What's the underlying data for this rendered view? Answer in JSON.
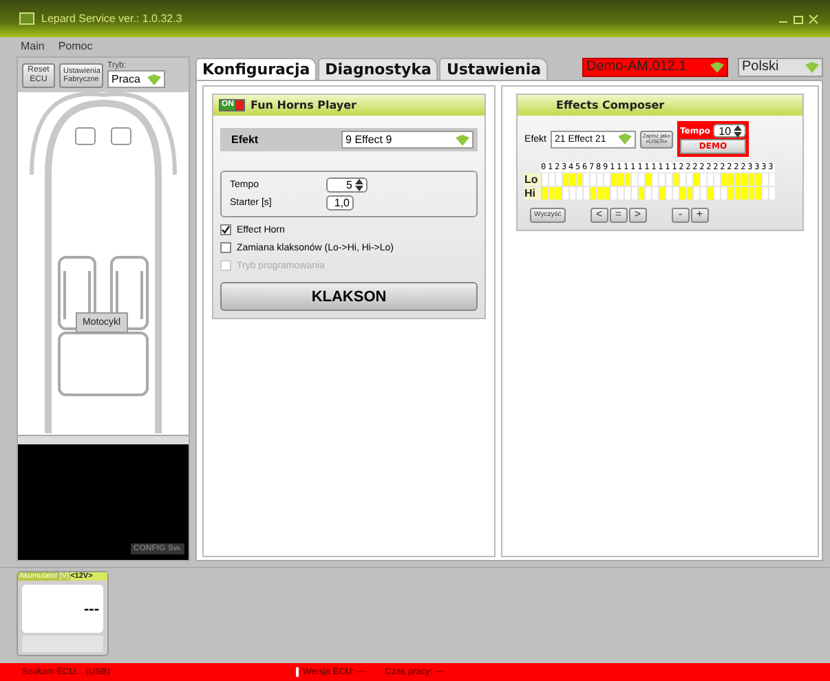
{
  "window": {
    "title": "Lepard Service  ver.: 1.0.32.3"
  },
  "menu": [
    "Main",
    "Pomoc"
  ],
  "left_panel": {
    "buttons": [
      "Reset ECU",
      "Ustawienia Fabryczne"
    ],
    "mode_label": "Tryb:",
    "mode_value": "Praca",
    "vehicle_button": "Motocykl",
    "config_label": "CONFIG Sw."
  },
  "tabs": [
    {
      "label": "Konfiguracja",
      "selected": true
    },
    {
      "label": "Diagnostyka",
      "selected": false
    },
    {
      "label": "Ustawienia",
      "selected": false
    }
  ],
  "device": {
    "value": "Demo-AM.012.1",
    "alert": true
  },
  "language": {
    "value": "Polski"
  },
  "fun_horns": {
    "title": "Fun Horns Player",
    "on": true,
    "switch_label": "ON",
    "effect_label": "Efekt",
    "effect_value": "9 Effect 9",
    "tempo_label": "Tempo",
    "tempo_value": "5",
    "starter_label": "Starter [s]",
    "starter_value": "1,0",
    "options": [
      {
        "label": "Effect Horn",
        "checked": true,
        "disabled": false
      },
      {
        "label": "Zamiana klaksonów (Lo->Hi, Hi->Lo)",
        "checked": false,
        "disabled": false
      },
      {
        "label": "Tryb programowania",
        "checked": false,
        "disabled": true
      }
    ],
    "horn_button": "KLAKSON"
  },
  "composer": {
    "title": "Effects Composer",
    "effect_label": "Efekt",
    "effect_value": "21 Effect 21",
    "save_button": "Zapisz jako «USER»",
    "tempo_label": "Tempo",
    "tempo_value": "10",
    "demo_button": "DEMO",
    "steps_header": "0123456789111111111122222222223333",
    "rows": [
      {
        "label": "Lo",
        "cells": [
          false,
          false,
          false,
          true,
          true,
          true,
          false,
          false,
          false,
          false,
          true,
          true,
          true,
          false,
          false,
          true,
          false,
          false,
          false,
          true,
          false,
          false,
          true,
          false,
          false,
          false,
          true,
          true,
          true,
          true,
          true,
          true,
          false,
          false
        ]
      },
      {
        "label": "Hi",
        "cells": [
          true,
          true,
          true,
          false,
          false,
          false,
          false,
          true,
          true,
          true,
          false,
          false,
          false,
          false,
          true,
          false,
          false,
          true,
          false,
          false,
          true,
          true,
          false,
          false,
          true,
          false,
          false,
          true,
          true,
          true,
          true,
          true,
          false,
          false
        ]
      }
    ],
    "buttons": [
      {
        "kind": "wide",
        "label": "Wyczyść"
      },
      {
        "kind": "gap"
      },
      {
        "kind": "small",
        "label": "<"
      },
      {
        "kind": "small",
        "label": "="
      },
      {
        "kind": "small",
        "label": ">"
      },
      {
        "kind": "gap"
      },
      {
        "kind": "small",
        "label": "-"
      },
      {
        "kind": "small",
        "label": "+"
      }
    ]
  },
  "battery": {
    "label": "Akumulator [V]",
    "badge": "<12V>",
    "value": "---"
  },
  "status_bar": [
    "Szukam ECU... (USB)",
    "Wersja ECU: ---",
    "Czas pracy: ---"
  ]
}
